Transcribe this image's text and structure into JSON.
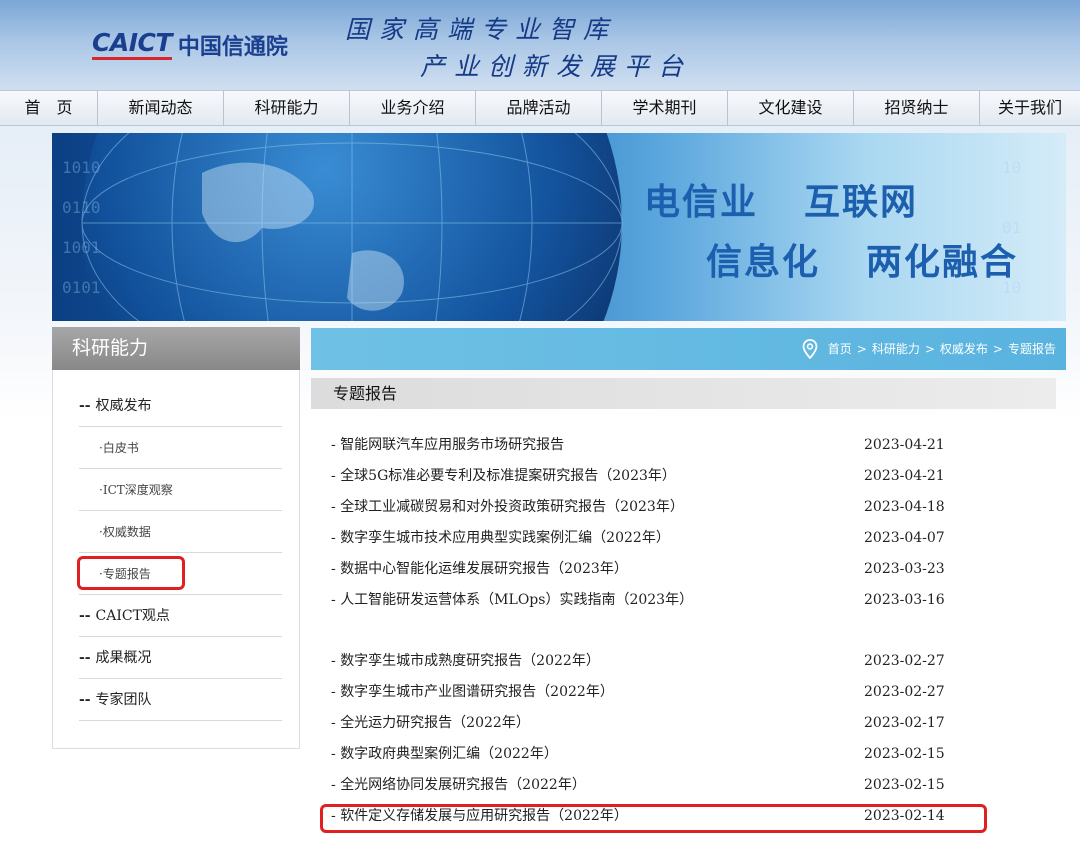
{
  "header": {
    "logo_en": "CAICT",
    "logo_cn": "中国信通院",
    "slogan_line1": "国家高端专业智库",
    "slogan_line2": "产业创新发展平台"
  },
  "nav": [
    "首　页",
    "新闻动态",
    "科研能力",
    "业务介绍",
    "品牌活动",
    "学术期刊",
    "文化建设",
    "招贤纳士",
    "关于我们"
  ],
  "banner": {
    "text1": "电信业",
    "text2": "互联网",
    "text3": "信息化",
    "text4": "两化融合"
  },
  "sidebar": {
    "title": "科研能力",
    "items": [
      {
        "label": "权威发布",
        "level": "main"
      },
      {
        "label": "白皮书",
        "level": "sub"
      },
      {
        "label": "ICT深度观察",
        "level": "sub"
      },
      {
        "label": "权威数据",
        "level": "sub"
      },
      {
        "label": "专题报告",
        "level": "sub",
        "highlighted": true
      },
      {
        "label": "CAICT观点",
        "level": "main"
      },
      {
        "label": "成果概况",
        "level": "main"
      },
      {
        "label": "专家团队",
        "level": "main"
      }
    ]
  },
  "breadcrumb": {
    "items": [
      "首页",
      "科研能力",
      "权威发布",
      "专题报告"
    ],
    "separator": ">"
  },
  "section_title": "专题报告",
  "reports_group1": [
    {
      "title": "智能网联汽车应用服务市场研究报告",
      "date": "2023-04-21"
    },
    {
      "title": "全球5G标准必要专利及标准提案研究报告（2023年）",
      "date": "2023-04-21"
    },
    {
      "title": "全球工业减碳贸易和对外投资政策研究报告（2023年）",
      "date": "2023-04-18"
    },
    {
      "title": "数字孪生城市技术应用典型实践案例汇编（2022年）",
      "date": "2023-04-07"
    },
    {
      "title": "数据中心智能化运维发展研究报告（2023年）",
      "date": "2023-03-23"
    },
    {
      "title": "人工智能研发运营体系（MLOps）实践指南（2023年）",
      "date": "2023-03-16"
    }
  ],
  "reports_group2": [
    {
      "title": "数字孪生城市成熟度研究报告（2022年）",
      "date": "2023-02-27"
    },
    {
      "title": "数字孪生城市产业图谱研究报告（2022年）",
      "date": "2023-02-27"
    },
    {
      "title": "全光运力研究报告（2022年）",
      "date": "2023-02-17"
    },
    {
      "title": "数字政府典型案例汇编（2022年）",
      "date": "2023-02-15"
    },
    {
      "title": "全光网络协同发展研究报告（2022年）",
      "date": "2023-02-15"
    },
    {
      "title": "软件定义存储发展与应用研究报告（2022年）",
      "date": "2023-02-14",
      "highlighted": true
    }
  ],
  "colors": {
    "brand_blue": "#1b3f8f",
    "highlight_red": "#e02020",
    "crumb_bar": "#5fb8e2"
  }
}
